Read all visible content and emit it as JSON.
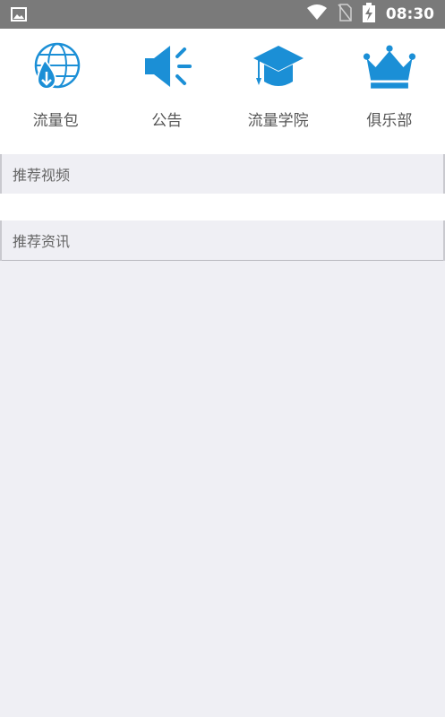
{
  "status_bar": {
    "time": "08:30",
    "icons": [
      "image-icon",
      "wifi-icon",
      "no-sim-icon",
      "battery-charging-icon"
    ]
  },
  "grid": {
    "items": [
      {
        "label": "流量包",
        "icon": "globe-download-icon"
      },
      {
        "label": "公告",
        "icon": "megaphone-icon"
      },
      {
        "label": "流量学院",
        "icon": "graduation-cap-icon"
      },
      {
        "label": "俱乐部",
        "icon": "crown-icon"
      }
    ]
  },
  "sections": {
    "videos_title": "推荐视频",
    "news_title": "推荐资讯"
  },
  "colors": {
    "accent": "#1b8fd6",
    "status_bar": "#7a7a7a",
    "background": "#efeff4"
  }
}
